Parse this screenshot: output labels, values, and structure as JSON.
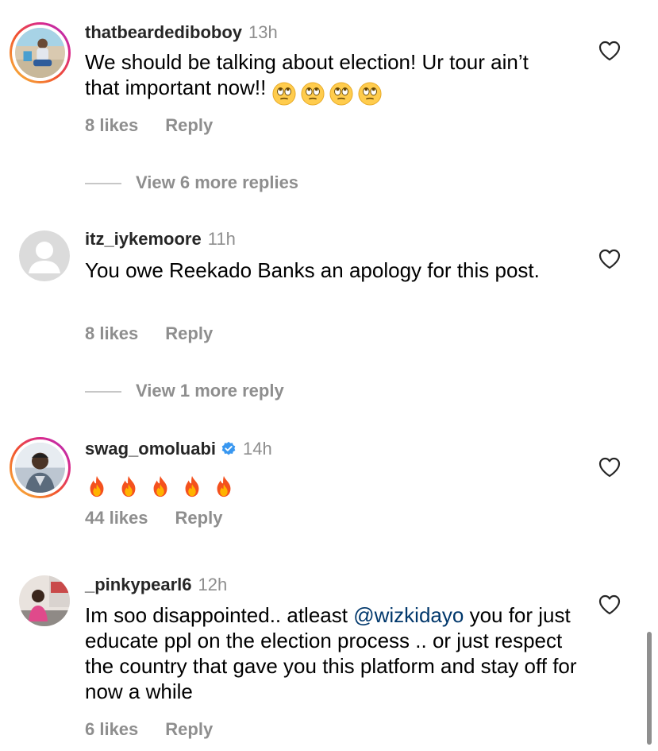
{
  "comments": [
    {
      "username": "thatbeardediboboy",
      "time": "13h",
      "text": "We should be talking about election! Ur tour ain’t that important now!!",
      "emoji": [
        "face-with-rolling-eyes",
        "face-with-rolling-eyes",
        "face-with-rolling-eyes",
        "face-with-rolling-eyes"
      ],
      "likes": "8 likes",
      "reply": "Reply",
      "view_replies": "View 6 more replies",
      "has_story_ring": true
    },
    {
      "username": "itz_iykemoore",
      "time": "11h",
      "text": "You owe Reekado Banks an apology for this post.",
      "likes": "8 likes",
      "reply": "Reply",
      "view_replies": "View 1 more reply",
      "has_story_ring": false
    },
    {
      "username": "swag_omoluabi",
      "verified": true,
      "time": "14h",
      "emoji": [
        "fire",
        "fire",
        "fire",
        "fire",
        "fire"
      ],
      "likes": "44 likes",
      "reply": "Reply",
      "has_story_ring": true
    },
    {
      "username": "_pinkypearl6",
      "time": "12h",
      "text_before": "Im soo disappointed.. atleast",
      "mention": "@wizkidayo",
      "text_after": "you for just educate ppl on the election process .. or just respect the country that gave you this platform and stay off for now a while",
      "likes": "6 likes",
      "reply": "Reply",
      "has_story_ring": false
    }
  ],
  "colors": {
    "secondary_text": "#8e8e8e",
    "mention": "#00376b",
    "verified_badge": "#3897f0"
  },
  "icons": {
    "like": "heart-outline-icon",
    "verified": "verified-badge-icon"
  }
}
